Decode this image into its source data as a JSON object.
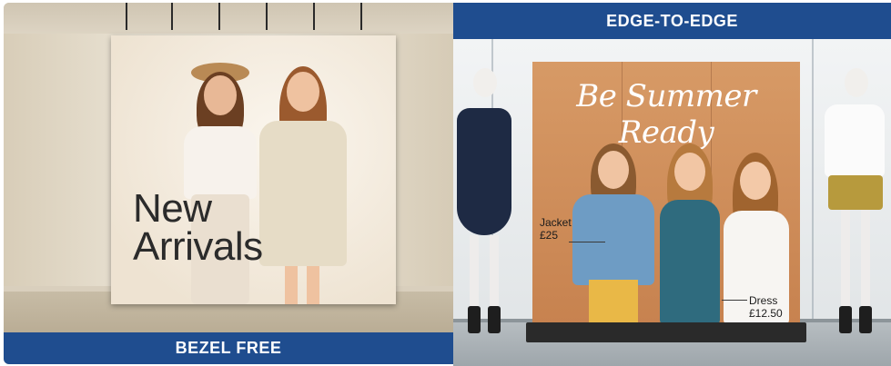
{
  "left_panel": {
    "caption": "BEZEL FREE",
    "screen_text_line1": "New",
    "screen_text_line2": "Arrivals"
  },
  "right_panel": {
    "caption": "EDGE-TO-EDGE",
    "screen_headline": "Be Summer Ready",
    "price_tag_1_item": "Jacket",
    "price_tag_1_price": "£25",
    "price_tag_2_item": "Dress",
    "price_tag_2_price": "£12.50"
  },
  "colors": {
    "banner_blue": "#1f4d8f",
    "screen_orange": "#c9874f"
  }
}
